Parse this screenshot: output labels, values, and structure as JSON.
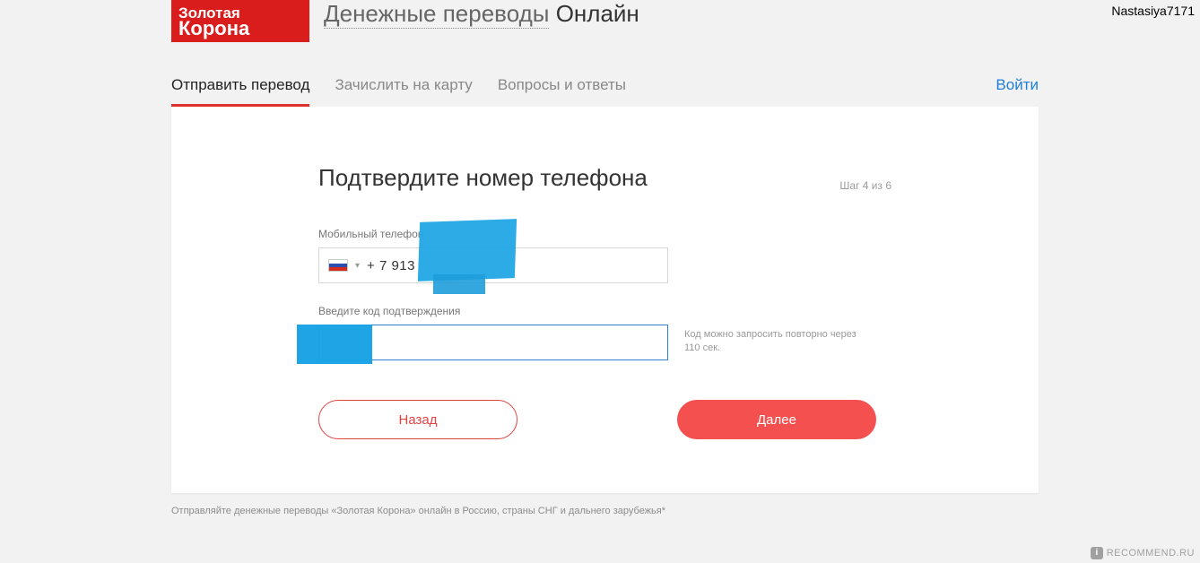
{
  "watermark_user": "Nastasiya7171",
  "site_watermark": {
    "badge": "i",
    "text": "RECOMMEND.RU"
  },
  "logo": {
    "line1": "Золотая",
    "line2": "Корона"
  },
  "header_title_ul": "Денежные переводы",
  "header_title_bold": "Онлайн",
  "nav": {
    "tabs": [
      {
        "label": "Отправить перевод",
        "active": true
      },
      {
        "label": "Зачислить на карту",
        "active": false
      },
      {
        "label": "Вопросы и ответы",
        "active": false
      }
    ],
    "login": "Войти"
  },
  "card": {
    "title": "Подтвердите номер телефона",
    "step": "Шаг 4 из 6",
    "phone_label": "Мобильный телефон",
    "phone_prefix": "+ 7 913",
    "code_label": "Введите код подтверждения",
    "resend_hint": "Код можно запросить повторно через 110 сек.",
    "back": "Назад",
    "next": "Далее"
  },
  "footnote": "Отправляйте денежные переводы «Золотая Корона» онлайн в Россию, страны СНГ и дальнего зарубежья*"
}
